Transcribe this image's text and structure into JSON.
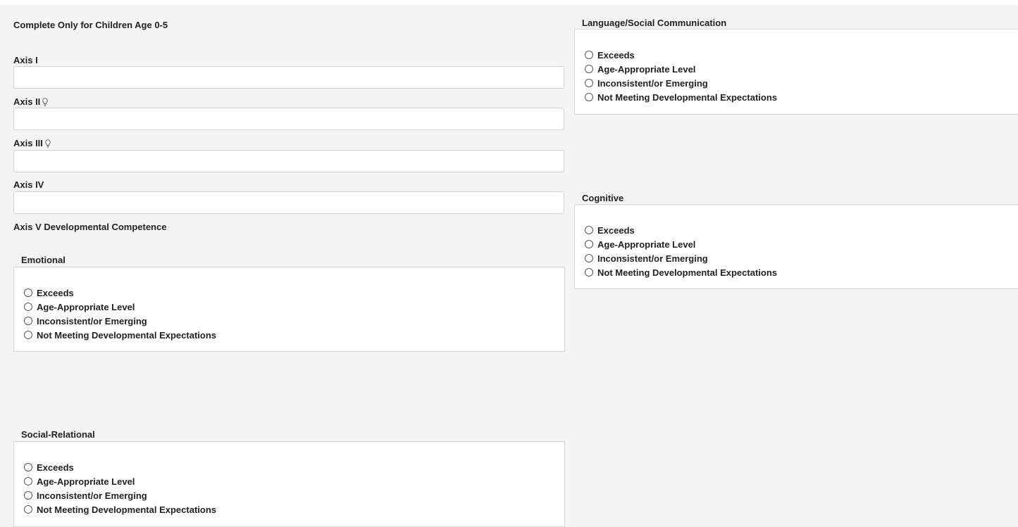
{
  "form": {
    "heading": "Complete Only for Children Age 0-5",
    "axis_fields": [
      {
        "label": "Axis I",
        "value": "",
        "has_hint": false
      },
      {
        "label": "Axis II",
        "value": "",
        "has_hint": true
      },
      {
        "label": "Axis III",
        "value": "",
        "has_hint": true
      },
      {
        "label": "Axis IV",
        "value": "",
        "has_hint": false
      }
    ],
    "axis5_label": "Axis V Developmental Competence"
  },
  "groups": {
    "emotional": {
      "legend": "Emotional",
      "options": [
        "Exceeds",
        "Age-Appropriate Level",
        "Inconsistent/or Emerging",
        "Not Meeting Developmental Expectations"
      ],
      "selected": null
    },
    "social": {
      "legend": "Social-Relational",
      "options": [
        "Exceeds",
        "Age-Appropriate Level",
        "Inconsistent/or Emerging",
        "Not Meeting Developmental Expectations"
      ],
      "selected": null
    },
    "language": {
      "legend": "Language/Social Communication",
      "options": [
        "Exceeds",
        "Age-Appropriate Level",
        "Inconsistent/or Emerging",
        "Not Meeting Developmental Expectations"
      ],
      "selected": null
    },
    "cognitive": {
      "legend": "Cognitive",
      "options": [
        "Exceeds",
        "Age-Appropriate Level",
        "Inconsistent/or Emerging",
        "Not Meeting Developmental Expectations"
      ],
      "selected": null
    }
  },
  "icons": {
    "hint": "lightbulb-icon"
  },
  "colors": {
    "page_background": "#f3f4f3",
    "panel_background": "#ffffff",
    "border": "#d4d7da",
    "text": "#222222"
  }
}
